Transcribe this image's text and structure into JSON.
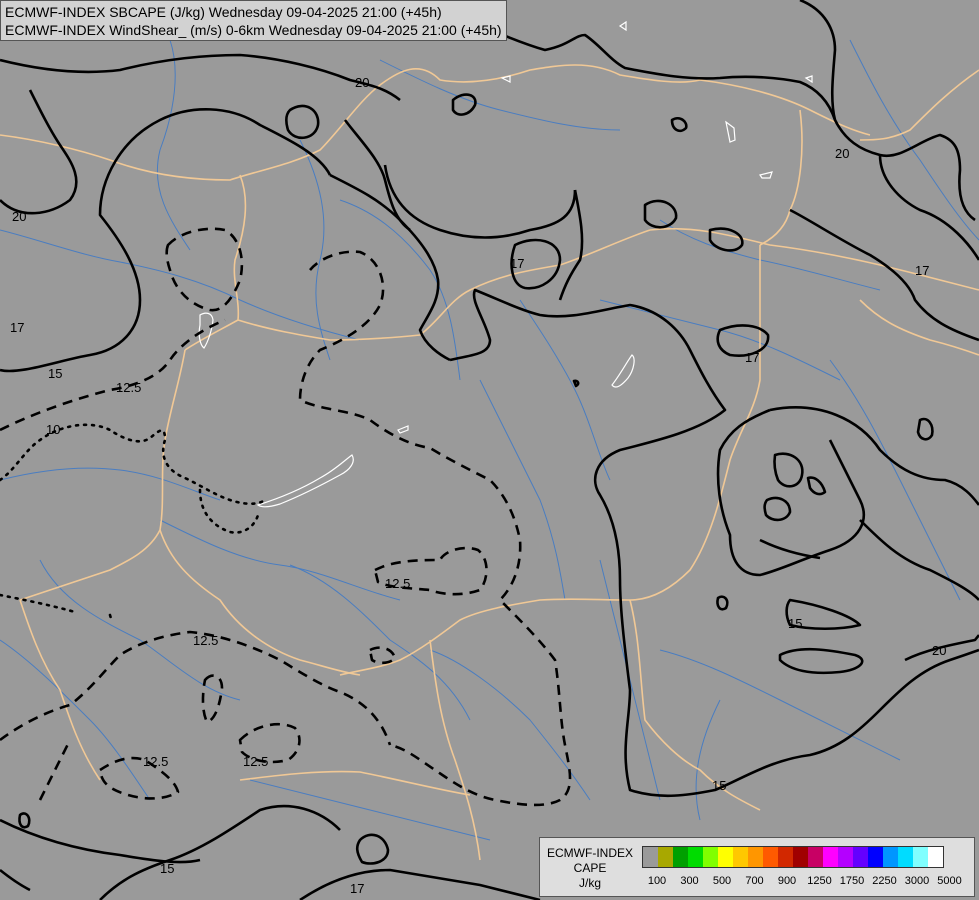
{
  "title": {
    "line1": "ECMWF-INDEX SBCAPE (J/kg) Wednesday 09-04-2025 21:00 (+45h)",
    "line2": "ECMWF-INDEX WindShear_ (m/s) 0-6km Wednesday 09-04-2025 21:00 (+45h)"
  },
  "contour_labels": {
    "l20a": "20",
    "l20b": "20",
    "l20c": "20",
    "l20d": "20",
    "l17a": "17",
    "l17b": "17",
    "l17c": "17",
    "l17d": "17",
    "l17e": "17",
    "l15a": "15",
    "l15b": "15",
    "l15c": "15",
    "l15d": "15",
    "l125a": "12.5",
    "l125b": "12.5",
    "l125c": "12.5",
    "l125d": "12.5",
    "l125e": "12.5",
    "l10": "10"
  },
  "legend": {
    "title_line1": "ECMWF-INDEX",
    "title_line2": "CAPE",
    "title_line3": "J/kg",
    "colors": [
      "#9a9a9a",
      "#a8a800",
      "#00a000",
      "#00dc00",
      "#80ff00",
      "#ffff00",
      "#ffc800",
      "#ff9600",
      "#ff5a00",
      "#d22800",
      "#a00000",
      "#c80064",
      "#ff00ff",
      "#b400ff",
      "#6400ff",
      "#0000ff",
      "#0096ff",
      "#00dcff",
      "#80ffff",
      "#ffffff"
    ],
    "ticks": [
      "100",
      "300",
      "500",
      "700",
      "900",
      "1250",
      "1750",
      "2250",
      "3000",
      "5000"
    ]
  },
  "colors": {
    "background": "#9a9a9a",
    "borders": "#f0c896",
    "rivers": "#3c78c8",
    "contours": "#000000",
    "lakes": "#ffffff"
  }
}
